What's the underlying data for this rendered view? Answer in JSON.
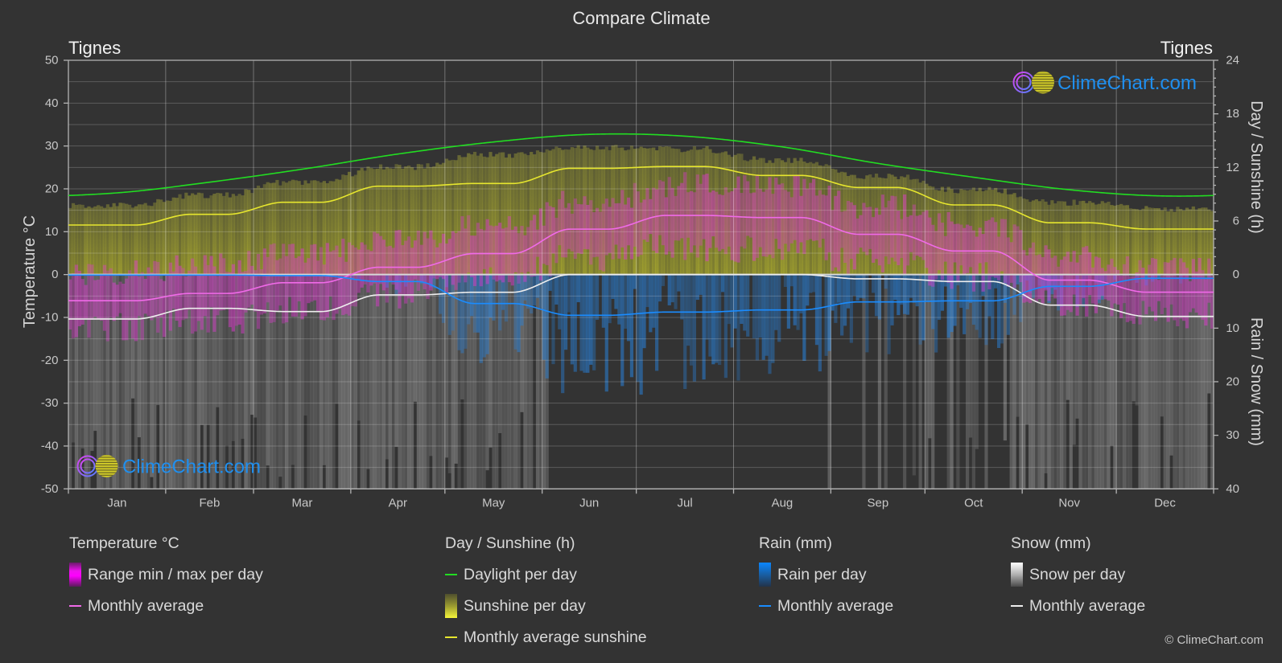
{
  "chart_data": {
    "type": "line",
    "title": "Compare Climate",
    "location_left": "Tignes",
    "location_right": "Tignes",
    "x": [
      "Jan",
      "Feb",
      "Mar",
      "Apr",
      "May",
      "Jun",
      "Jul",
      "Aug",
      "Sep",
      "Oct",
      "Nov",
      "Dec"
    ],
    "days_per_month": [
      31,
      28,
      31,
      30,
      31,
      30,
      31,
      31,
      30,
      31,
      30,
      31
    ],
    "grid": true,
    "axes": {
      "temperature": {
        "label": "Temperature °C",
        "side": "left",
        "range": [
          -50,
          50
        ],
        "ticks": [
          50,
          40,
          30,
          20,
          10,
          0,
          -10,
          -20,
          -30,
          -40,
          -50
        ]
      },
      "sunshine": {
        "label": "Day / Sunshine (h)",
        "side": "right-top",
        "range": [
          0,
          24
        ],
        "ticks": [
          24,
          18,
          12,
          6,
          0
        ]
      },
      "precipitation": {
        "label": "Rain / Snow (mm)",
        "side": "right-bottom",
        "range": [
          0,
          40
        ],
        "inverted": true,
        "ticks": [
          10,
          20,
          30,
          40
        ]
      }
    },
    "series": [
      {
        "key": "daylight",
        "name": "Daylight per day",
        "axis": "sunshine",
        "unit": "h",
        "color": "#22dd22",
        "values": [
          9.15,
          10.35,
          11.8,
          13.5,
          14.85,
          15.7,
          15.5,
          14.3,
          12.45,
          10.9,
          9.5,
          8.8
        ]
      },
      {
        "key": "sunshine_avg",
        "name": "Monthly average sunshine",
        "axis": "sunshine",
        "unit": "h",
        "color": "#e6e62e",
        "values": [
          5.55,
          6.75,
          8.1,
          9.9,
          10.2,
          11.9,
          12.1,
          11.1,
          9.75,
          7.8,
          5.8,
          5.1
        ]
      },
      {
        "key": "temp_avg",
        "name": "Temperature monthly average",
        "axis": "temperature",
        "unit": "°C",
        "color": "#f06ae8",
        "values": [
          -6.1,
          -4.4,
          -1.9,
          1.7,
          4.9,
          10.6,
          13.8,
          13.3,
          9.4,
          5.5,
          -1.3,
          -4.1
        ]
      },
      {
        "key": "rain_avg",
        "name": "Rain monthly average",
        "axis": "precipitation",
        "unit": "mm",
        "color": "#1a8cff",
        "values": [
          0.1,
          0.1,
          0.2,
          1.3,
          5.4,
          7.6,
          7.0,
          6.6,
          5.1,
          4.9,
          2.2,
          0.7
        ]
      },
      {
        "key": "snow_avg",
        "name": "Snow monthly average",
        "axis": "precipitation",
        "unit": "mm",
        "color": "#eeeeee",
        "values": [
          8.3,
          6.3,
          6.9,
          3.8,
          3.3,
          0.0,
          0.0,
          0.0,
          0.8,
          1.3,
          5.7,
          7.8
        ]
      }
    ],
    "bands": [
      {
        "key": "temp_range",
        "name": "Range min / max per day",
        "axis": "temperature",
        "unit": "°C",
        "color": "#e137d2",
        "max": [
          0.5,
          2.0,
          4.5,
          8.0,
          11.0,
          17.0,
          21.0,
          20.5,
          16.0,
          11.5,
          4.0,
          1.0
        ],
        "min": [
          -12.5,
          -11.0,
          -8.5,
          -4.5,
          -1.5,
          4.0,
          6.5,
          6.0,
          3.0,
          -0.5,
          -6.5,
          -9.5
        ]
      },
      {
        "key": "sunshine_daily",
        "name": "Sunshine per day",
        "axis": "sunshine",
        "unit": "h",
        "color": "#d2d22c",
        "max": [
          7.7,
          8.9,
          10.35,
          12.05,
          13.4,
          14.25,
          14.05,
          12.85,
          11.0,
          9.45,
          8.05,
          7.35
        ],
        "min": [
          0,
          0,
          0,
          0,
          0,
          0,
          0,
          0,
          0,
          0,
          0,
          0
        ]
      }
    ],
    "daily_bars": [
      {
        "key": "rain_daily",
        "name": "Rain per day",
        "axis": "precipitation",
        "color": "#2882dc"
      },
      {
        "key": "snow_daily",
        "name": "Snow per day",
        "axis": "precipitation",
        "color": "#aaaaaa"
      }
    ],
    "legend_placement": "bottom"
  },
  "legend": {
    "groups": [
      {
        "title": "Temperature °C",
        "items": [
          {
            "label": "Range min / max per day"
          },
          {
            "label": "Monthly average"
          }
        ]
      },
      {
        "title": "Day / Sunshine (h)",
        "items": [
          {
            "label": "Daylight per day"
          },
          {
            "label": "Sunshine per day"
          },
          {
            "label": "Monthly average sunshine"
          }
        ]
      },
      {
        "title": "Rain (mm)",
        "items": [
          {
            "label": "Rain per day"
          },
          {
            "label": "Monthly average"
          }
        ]
      },
      {
        "title": "Snow (mm)",
        "items": [
          {
            "label": "Snow per day"
          },
          {
            "label": "Monthly average"
          }
        ]
      }
    ],
    "colors": {
      "temp_avg_line": "#f06ae8",
      "daylight_line": "#22dd22",
      "sunshine_avg_line": "#e6e62e",
      "rain_avg_line": "#1a8cff",
      "snow_avg_line": "#eeeeee"
    }
  },
  "watermark": {
    "text": "ClimeChart.com",
    "color": "#1f8fef"
  },
  "footer": {
    "copyright": "© ClimeChart.com"
  }
}
